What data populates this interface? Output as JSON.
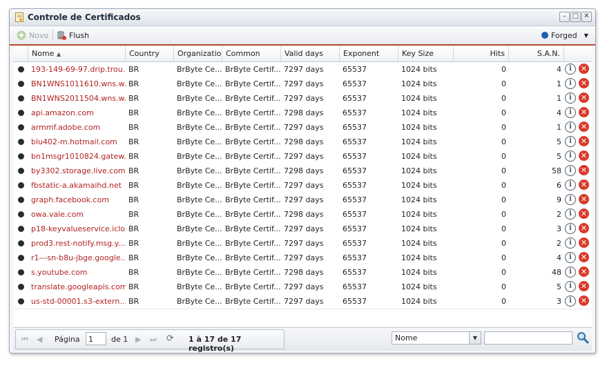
{
  "window": {
    "title": "Controle de Certificados",
    "min": "–",
    "max": "□",
    "close": "✕"
  },
  "toolbar": {
    "new_label": "Novo",
    "flush_label": "Flush",
    "mode_label": "Forged",
    "mode_color": "#1f5fa8"
  },
  "grid": {
    "columns": [
      "Nome",
      "Country",
      "Organization",
      "Common",
      "Valid days",
      "Exponent",
      "Key Size",
      "Hits",
      "S.A.N."
    ],
    "rows": [
      {
        "nome": "193-149-69-97.drip.trou...",
        "country": "BR",
        "org": "BrByte Ce...",
        "common": "BrByte Certif...",
        "valid": "7297 days",
        "exp": "65537",
        "key": "1024 bits",
        "hits": "0",
        "san": "4"
      },
      {
        "nome": "BN1WNS1011610.wns.w...",
        "country": "BR",
        "org": "BrByte Ce...",
        "common": "BrByte Certif...",
        "valid": "7297 days",
        "exp": "65537",
        "key": "1024 bits",
        "hits": "0",
        "san": "1"
      },
      {
        "nome": "BN1WNS2011504.wns.w...",
        "country": "BR",
        "org": "BrByte Ce...",
        "common": "BrByte Certif...",
        "valid": "7297 days",
        "exp": "65537",
        "key": "1024 bits",
        "hits": "0",
        "san": "1"
      },
      {
        "nome": "api.amazon.com",
        "country": "BR",
        "org": "BrByte Ce...",
        "common": "BrByte Certif...",
        "valid": "7298 days",
        "exp": "65537",
        "key": "1024 bits",
        "hits": "0",
        "san": "4"
      },
      {
        "nome": "armmf.adobe.com",
        "country": "BR",
        "org": "BrByte Ce...",
        "common": "BrByte Certif...",
        "valid": "7297 days",
        "exp": "65537",
        "key": "1024 bits",
        "hits": "0",
        "san": "1"
      },
      {
        "nome": "blu402-m.hotmail.com",
        "country": "BR",
        "org": "BrByte Ce...",
        "common": "BrByte Certif...",
        "valid": "7298 days",
        "exp": "65537",
        "key": "1024 bits",
        "hits": "0",
        "san": "5"
      },
      {
        "nome": "bn1msgr1010824.gatew...",
        "country": "BR",
        "org": "BrByte Ce...",
        "common": "BrByte Certif...",
        "valid": "7297 days",
        "exp": "65537",
        "key": "1024 bits",
        "hits": "0",
        "san": "5"
      },
      {
        "nome": "by3302.storage.live.com",
        "country": "BR",
        "org": "BrByte Ce...",
        "common": "BrByte Certif...",
        "valid": "7298 days",
        "exp": "65537",
        "key": "1024 bits",
        "hits": "0",
        "san": "58"
      },
      {
        "nome": "fbstatic-a.akamaihd.net",
        "country": "BR",
        "org": "BrByte Ce...",
        "common": "BrByte Certif...",
        "valid": "7297 days",
        "exp": "65537",
        "key": "1024 bits",
        "hits": "0",
        "san": "6"
      },
      {
        "nome": "graph.facebook.com",
        "country": "BR",
        "org": "BrByte Ce...",
        "common": "BrByte Certif...",
        "valid": "7297 days",
        "exp": "65537",
        "key": "1024 bits",
        "hits": "0",
        "san": "9"
      },
      {
        "nome": "owa.vale.com",
        "country": "BR",
        "org": "BrByte Ce...",
        "common": "BrByte Certif...",
        "valid": "7298 days",
        "exp": "65537",
        "key": "1024 bits",
        "hits": "0",
        "san": "2"
      },
      {
        "nome": "p18-keyvalueservice.iclo...",
        "country": "BR",
        "org": "BrByte Ce...",
        "common": "BrByte Certif...",
        "valid": "7297 days",
        "exp": "65537",
        "key": "1024 bits",
        "hits": "0",
        "san": "3"
      },
      {
        "nome": "prod3.rest-notify.msg.y...",
        "country": "BR",
        "org": "BrByte Ce...",
        "common": "BrByte Certif...",
        "valid": "7297 days",
        "exp": "65537",
        "key": "1024 bits",
        "hits": "0",
        "san": "2"
      },
      {
        "nome": "r1---sn-b8u-jbge.google...",
        "country": "BR",
        "org": "BrByte Ce...",
        "common": "BrByte Certif...",
        "valid": "7297 days",
        "exp": "65537",
        "key": "1024 bits",
        "hits": "0",
        "san": "4"
      },
      {
        "nome": "s.youtube.com",
        "country": "BR",
        "org": "BrByte Ce...",
        "common": "BrByte Certif...",
        "valid": "7298 days",
        "exp": "65537",
        "key": "1024 bits",
        "hits": "0",
        "san": "48"
      },
      {
        "nome": "translate.googleapis.com",
        "country": "BR",
        "org": "BrByte Ce...",
        "common": "BrByte Certif...",
        "valid": "7297 days",
        "exp": "65537",
        "key": "1024 bits",
        "hits": "0",
        "san": "5"
      },
      {
        "nome": "us-std-00001.s3-extern...",
        "country": "BR",
        "org": "BrByte Ce...",
        "common": "BrByte Certif...",
        "valid": "7297 days",
        "exp": "65537",
        "key": "1024 bits",
        "hits": "0",
        "san": "3"
      }
    ]
  },
  "pager": {
    "page_label": "Página",
    "page_value": "1",
    "of_label": "de 1",
    "summary": "1 à 17 de 17 registro(s)",
    "search_field": "Nome",
    "search_value": ""
  },
  "colors": {
    "accent": "#b94a2c",
    "name_text": "#b22222",
    "delete": "#d93a2b"
  }
}
